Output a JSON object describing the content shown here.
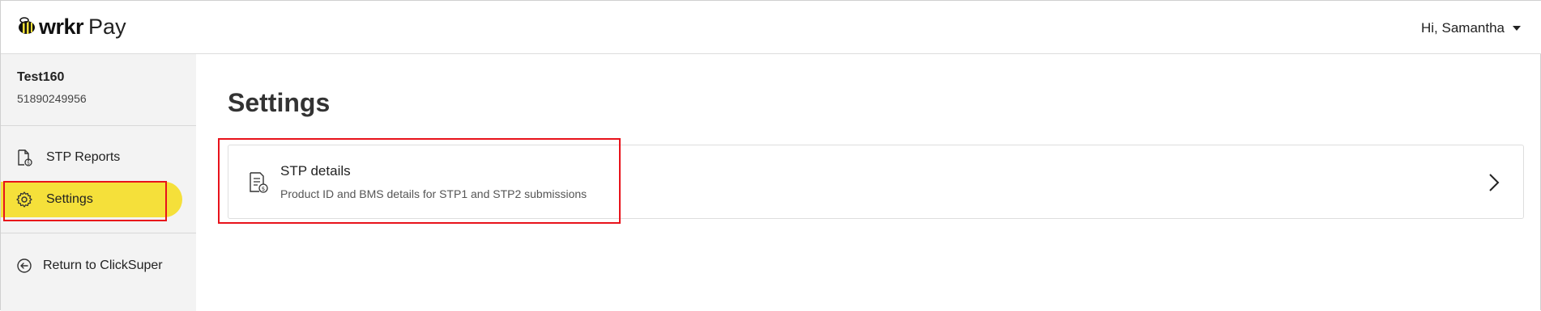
{
  "header": {
    "brand": "wrkr",
    "product": "Pay",
    "greeting": "Hi, Samantha"
  },
  "account": {
    "name": "Test160",
    "number": "51890249956"
  },
  "sidebar": {
    "items": [
      {
        "label": "STP Reports",
        "icon": "document-dollar-icon",
        "active": false
      },
      {
        "label": "Settings",
        "icon": "gear-icon",
        "active": true
      },
      {
        "label": "Return to ClickSuper",
        "icon": "arrow-left-circle-icon",
        "active": false
      }
    ]
  },
  "main": {
    "title": "Settings",
    "cards": [
      {
        "title": "STP details",
        "description": "Product ID and BMS details for STP1 and STP2 submissions",
        "icon": "document-list-icon"
      }
    ]
  },
  "colors": {
    "accent": "#f5e03a",
    "highlight": "#e8121b",
    "sidebar_bg": "#f3f3f3"
  }
}
